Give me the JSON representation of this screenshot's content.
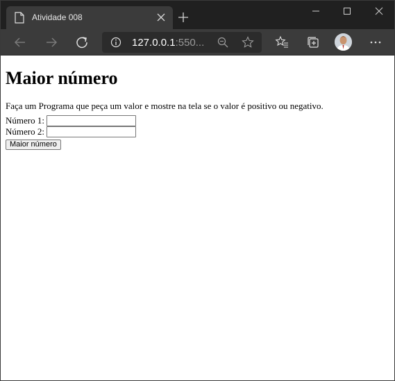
{
  "browser": {
    "tab_title": "Atividade 008",
    "url_host": "127.0.0.1",
    "url_rest": ":550...",
    "icons": [
      "page-icon",
      "close-icon",
      "plus-icon",
      "minimize-icon",
      "maximize-icon",
      "window-close-icon",
      "back-arrow-icon",
      "forward-arrow-icon",
      "refresh-icon",
      "info-icon",
      "zoom-icon",
      "star-icon",
      "favorites-icon",
      "collections-icon",
      "avatar",
      "more-icon"
    ]
  },
  "page": {
    "heading": "Maior número",
    "description": "Faça um Programa que peça um valor e mostre na tela se o valor é positivo ou negativo.",
    "field1_label": "Número 1:",
    "field1_value": "",
    "field2_label": "Número 2:",
    "field2_value": "",
    "button_label": "Maior número"
  }
}
